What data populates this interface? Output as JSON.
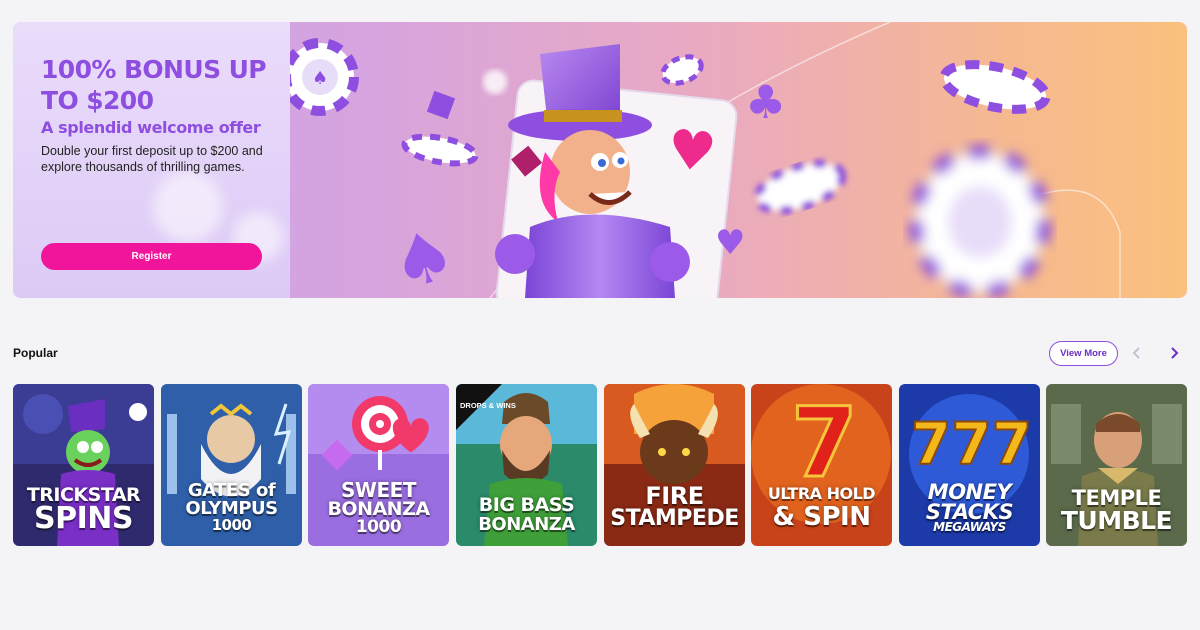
{
  "hero": {
    "title": "100% BONUS UP TO $200",
    "subtitle": "A splendid welcome offer",
    "description": "Double your first deposit up to $200 and explore thousands of thrilling games.",
    "register_label": "Register"
  },
  "popular": {
    "title": "Popular",
    "view_more_label": "View More",
    "games": [
      {
        "title": "TRICKSTAR SPINS",
        "line1": "TRICKSTAR",
        "line2": "SPINS",
        "line3": ""
      },
      {
        "title": "GATES OF OLYMPUS 1000",
        "line1": "GATES of",
        "line2": "OLYMPUS",
        "line3": "1000"
      },
      {
        "title": "SWEET BONANZA 1000",
        "line1": "SWEET",
        "line2": "BONANZA",
        "line3": "1000"
      },
      {
        "title": "BIG BASS BONANZA",
        "line1": "BIG BASS",
        "line2": "BONANZA",
        "line3": "",
        "badge": "DROPS & WINS"
      },
      {
        "title": "FIRE STAMPEDE",
        "line1": "FIRE",
        "line2": "STAMPEDE",
        "line3": ""
      },
      {
        "title": "ULTRA HOLD & SPIN",
        "line1": "ULTRA HOLD",
        "line2": "& SPIN",
        "line3": ""
      },
      {
        "title": "MONEY STACKS MEGAWAYS",
        "line1": "MONEY",
        "line2": "STACKS",
        "line3": "MEGAWAYS"
      },
      {
        "title": "TEMPLE TUMBLE",
        "line1": "TEMPLE",
        "line2": "TUMBLE",
        "line3": ""
      }
    ]
  },
  "colors": {
    "accent_purple": "#8e4ee0",
    "register_pink": "#f0159a",
    "page_background": "#f4f4f6"
  },
  "icons": {
    "prev": "chevron-left-icon",
    "next": "chevron-right-icon"
  }
}
